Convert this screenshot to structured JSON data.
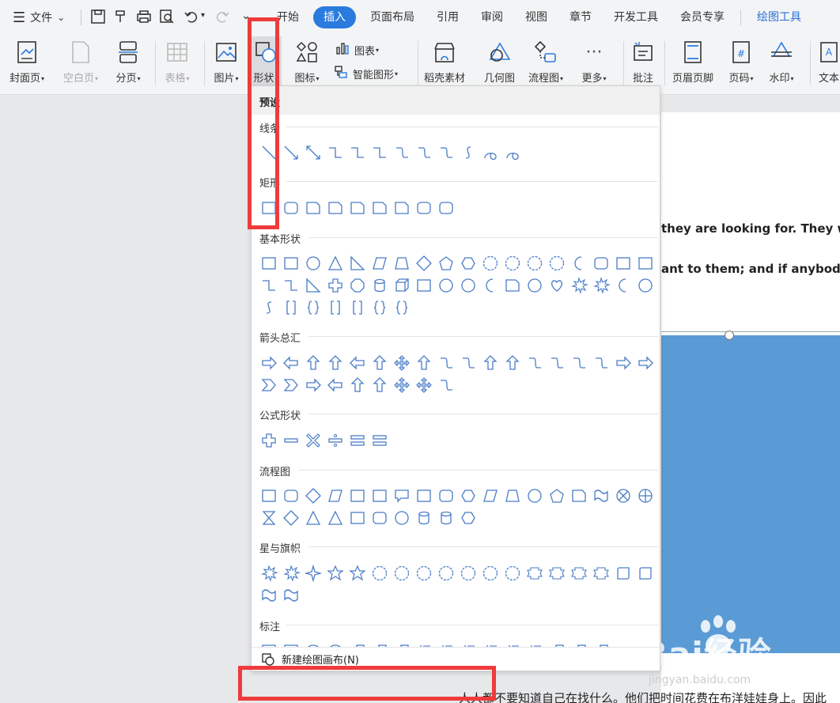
{
  "menubar": {
    "file_label": "文件",
    "tabs": [
      {
        "label": "开始",
        "active": false
      },
      {
        "label": "插入",
        "active": true
      },
      {
        "label": "页面布局",
        "active": false
      },
      {
        "label": "引用",
        "active": false
      },
      {
        "label": "审阅",
        "active": false
      },
      {
        "label": "视图",
        "active": false
      },
      {
        "label": "章节",
        "active": false
      },
      {
        "label": "开发工具",
        "active": false
      },
      {
        "label": "会员专享",
        "active": false
      },
      {
        "label": "绘图工具",
        "active": false
      }
    ]
  },
  "ribbon": {
    "cover": "封面页",
    "blank": "空白页",
    "pagebreak": "分页",
    "table": "表格",
    "picture": "图片",
    "shape": "形状",
    "icons": "图标",
    "chart": "图表",
    "smartart": "智能图形",
    "material": "稻壳素材",
    "geometry": "几何图",
    "flowchart": "流程图",
    "more": "更多",
    "comment": "批注",
    "headerfooter": "页眉页脚",
    "pagenum": "页码",
    "watermark": "水印",
    "textbox": "文本"
  },
  "dropdown": {
    "header": "预设",
    "sections": {
      "lines": "线条",
      "rect": "矩形",
      "basic": "基本形状",
      "arrows": "箭头总汇",
      "formula": "公式形状",
      "flow": "流程图",
      "stars": "星与旗帜",
      "callouts": "标注"
    },
    "footer": "新建绘图画布(N)"
  },
  "document": {
    "line1": "they are looking for. They wa",
    "line2": "ant to them; and if anybody t",
    "bottom": "人人都不要知道自己在找什么。他们把时间花费在布洋娃娃身上。因此"
  },
  "watermark": {
    "text": "Bai经验",
    "sub": "jingyan.baidu.com"
  }
}
